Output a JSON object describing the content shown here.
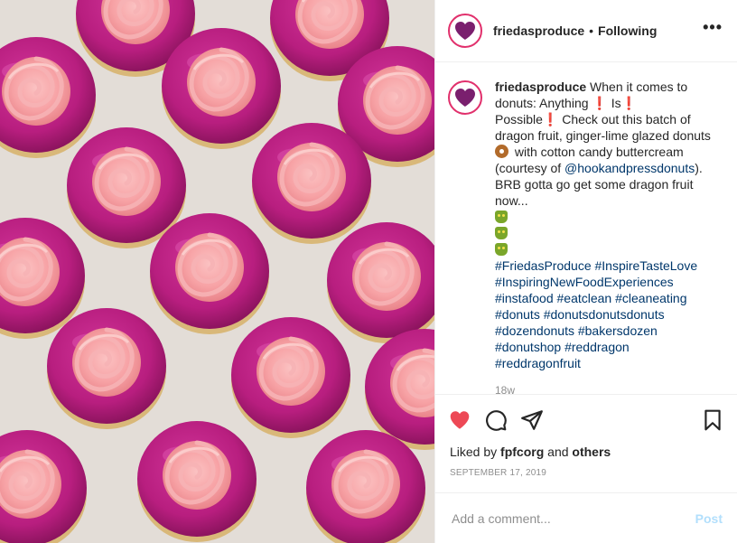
{
  "header": {
    "username": "friedasproduce",
    "separator": "•",
    "following": "Following",
    "more": "•••"
  },
  "caption": {
    "username": "friedasproduce",
    "lines": [
      "When it comes to",
      "donuts: Anything",
      "Is",
      "Possible",
      "Check out this batch of",
      "dragon fruit, ginger-lime glazed donuts",
      "with cotton candy buttercream",
      "(courtesy of",
      "@hookandpressdonuts",
      ").",
      "BRB gotta go get some dragon fruit",
      "now..."
    ],
    "exclamation": "❗",
    "hashtags": [
      "#FriedasProduce #InspireTasteLove",
      "#InspiringNewFoodExperiences",
      "#instafood #eatclean #cleaneating",
      "#donuts #donutsdonutsdonuts",
      "#dozendonuts #bakersdozen",
      "#donutshop #reddragon",
      "#reddragonfruit"
    ],
    "time_ago": "18w"
  },
  "likes": {
    "prefix": "Liked by",
    "user": "fpfcorg",
    "and": "and",
    "others": "others"
  },
  "date": "SEPTEMBER 17, 2019",
  "comment_box": {
    "placeholder": "Add a comment...",
    "post_label": "Post"
  },
  "colors": {
    "like": "#ed4956",
    "link": "#00376b",
    "avatar_ring": "#e1306c",
    "logo": "#7a1f6e"
  },
  "icons": [
    "heart-icon",
    "comment-icon",
    "share-icon",
    "bookmark-icon",
    "more-icon"
  ]
}
